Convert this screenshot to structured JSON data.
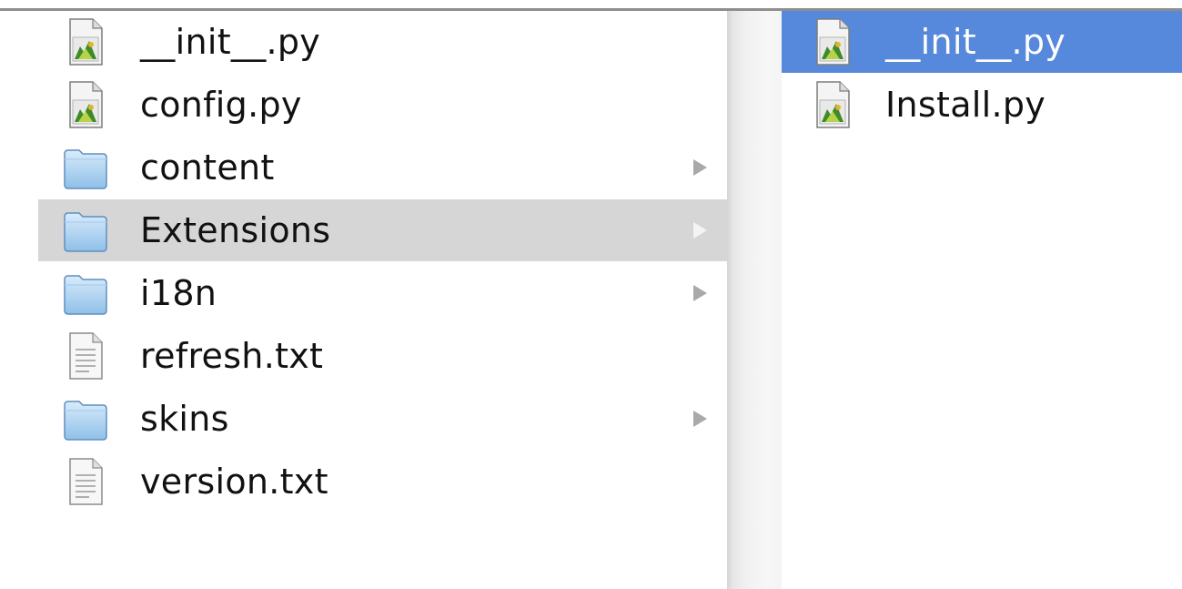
{
  "colors": {
    "selected_parent_bg": "#d6d6d6",
    "selected_item_bg": "#5688dc",
    "text": "#111111",
    "selected_text": "#ffffff",
    "chevron": "#a9a9a9"
  },
  "column1": {
    "items": [
      {
        "label": "__init__.py",
        "icon": "python-file-icon",
        "has_children": false,
        "state": "normal"
      },
      {
        "label": "config.py",
        "icon": "python-file-icon",
        "has_children": false,
        "state": "normal"
      },
      {
        "label": "content",
        "icon": "folder-icon",
        "has_children": true,
        "state": "normal"
      },
      {
        "label": "Extensions",
        "icon": "folder-icon",
        "has_children": true,
        "state": "selected-parent"
      },
      {
        "label": "i18n",
        "icon": "folder-icon",
        "has_children": true,
        "state": "normal"
      },
      {
        "label": "refresh.txt",
        "icon": "text-file-icon",
        "has_children": false,
        "state": "normal"
      },
      {
        "label": "skins",
        "icon": "folder-icon",
        "has_children": true,
        "state": "normal"
      },
      {
        "label": "version.txt",
        "icon": "text-file-icon",
        "has_children": false,
        "state": "normal"
      }
    ]
  },
  "column2": {
    "items": [
      {
        "label": "__init__.py",
        "icon": "python-file-icon",
        "has_children": false,
        "state": "selected"
      },
      {
        "label": "Install.py",
        "icon": "python-file-icon",
        "has_children": false,
        "state": "normal"
      }
    ]
  }
}
